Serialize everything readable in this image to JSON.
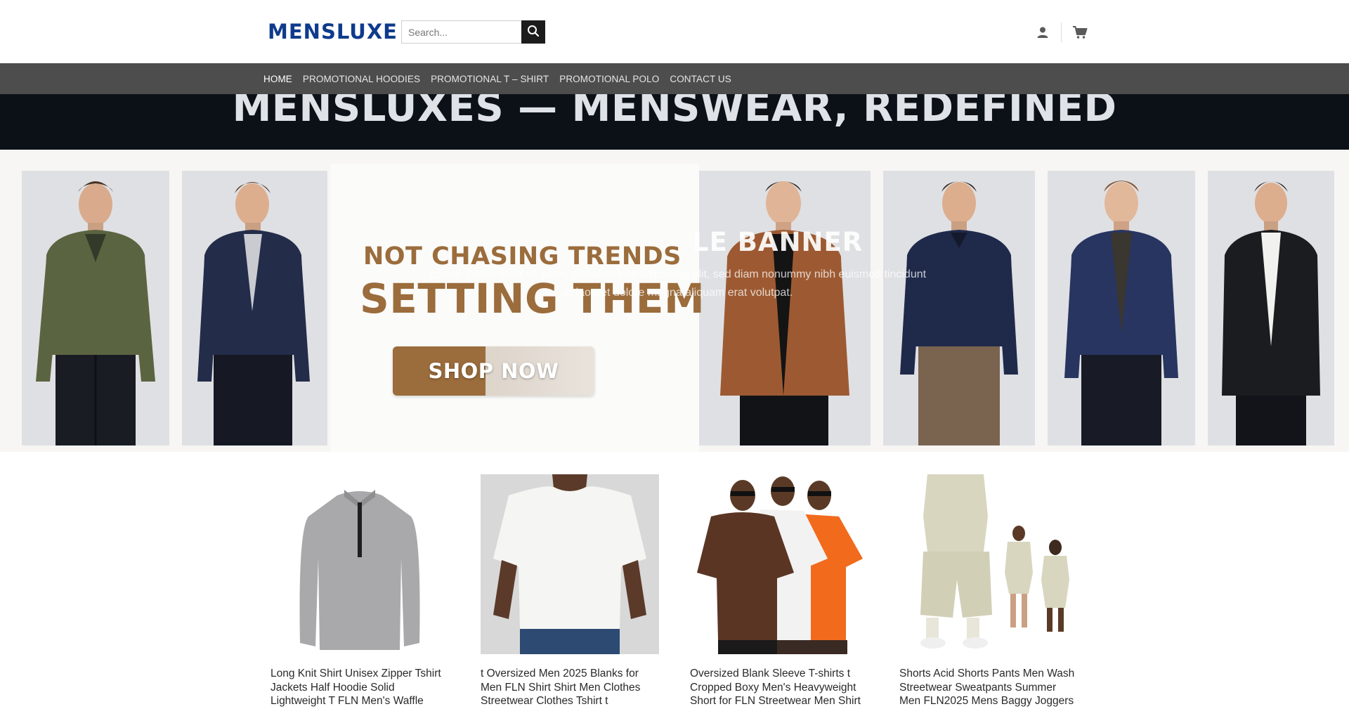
{
  "header": {
    "logo": "MENSLUXE",
    "search": {
      "placeholder": "Search..."
    },
    "icons": {
      "search": "search-icon",
      "user": "user-icon",
      "cart": "cart-icon"
    }
  },
  "nav": {
    "items": [
      {
        "label": "HOME",
        "active": true
      },
      {
        "label": "PROMOTIONAL HOODIES",
        "active": false
      },
      {
        "label": "PROMOTIONAL T – SHIRT",
        "active": false
      },
      {
        "label": "PROMOTIONAL POLO",
        "active": false
      },
      {
        "label": "CONTACT US",
        "active": false
      }
    ]
  },
  "hero": {
    "title": "MENSLUXES — MENSWEAR, REDEFINED"
  },
  "banner": {
    "tagline_1": "NOT CHASING TRENDS",
    "tagline_2": "SETTING THEM",
    "cta": "SHOP NOW",
    "overlay_title": "LE BANNER",
    "overlay_text": "Lorem ipsum dolor sit amet, consectetuer adipiscing elit, sed diam nonummy nibh euismod tincidunt ut laoreet dolore magna aliquam erat volutpat."
  },
  "products": [
    {
      "name": "Long Knit Shirt Unisex Zipper Tshirt Jackets Half Hoodie Solid Lightweight T FLN Men's Waffle Sleeve Pullover"
    },
    {
      "name": "t Oversized Men 2025 Blanks for Men FLN Shirt Shirt Men Clothes Streetwear Clothes Tshirt t"
    },
    {
      "name": "Oversized Blank Sleeve T-shirts t Cropped Boxy Men's Heavyweight Short for FLN Streetwear Men Shirt"
    },
    {
      "name": "Shorts Acid Shorts Pants Men Wash Streetwear Sweatpants Summer Men FLN2025 Mens Baggy Joggers Cotton"
    }
  ],
  "colors": {
    "brand": "#0f3b8c",
    "nav_bg": "#4d4d4d",
    "hero_bg": "#0c1118",
    "accent_brown": "#9b6c3c"
  }
}
